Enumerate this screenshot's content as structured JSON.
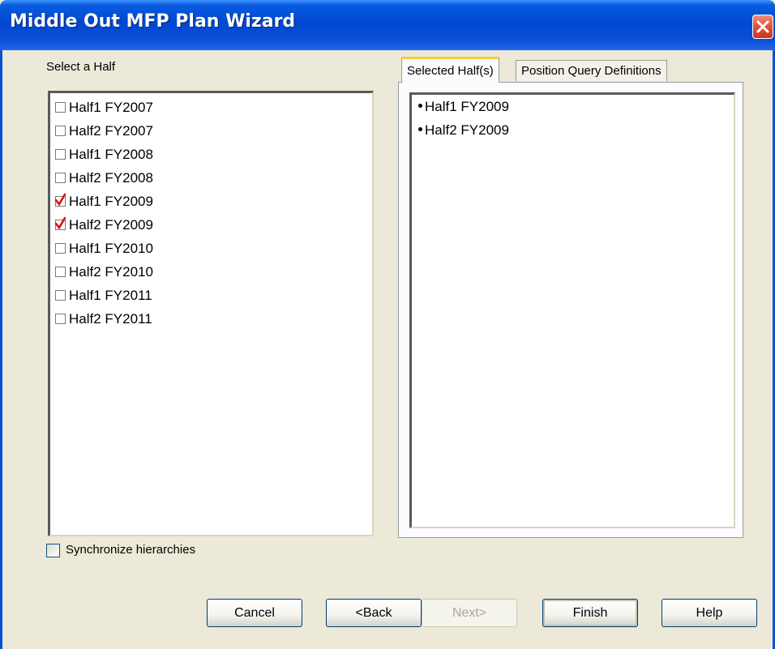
{
  "window": {
    "title": "Middle Out MFP Plan Wizard",
    "titlebar_color": "#0a4fd6",
    "close_icon": "close-icon"
  },
  "left_panel": {
    "label": "Select a Half",
    "items": [
      {
        "label": "Half1 FY2007",
        "checked": false
      },
      {
        "label": "Half2 FY2007",
        "checked": false
      },
      {
        "label": "Half1 FY2008",
        "checked": false
      },
      {
        "label": "Half2 FY2008",
        "checked": false
      },
      {
        "label": "Half1 FY2009",
        "checked": true
      },
      {
        "label": "Half2 FY2009",
        "checked": true
      },
      {
        "label": "Half1 FY2010",
        "checked": false
      },
      {
        "label": "Half2 FY2010",
        "checked": false
      },
      {
        "label": "Half1 FY2011",
        "checked": false
      },
      {
        "label": "Half2 FY2011",
        "checked": false
      }
    ],
    "check_color": "#e01010"
  },
  "tabs": [
    {
      "label": "Selected Half(s)",
      "active": true
    },
    {
      "label": "Position Query Definitions",
      "active": false
    }
  ],
  "selected_list": {
    "items": [
      "Half1 FY2009",
      "Half2 FY2009"
    ]
  },
  "sync": {
    "label": "Synchronize hierarchies",
    "checked": false
  },
  "buttons": {
    "cancel": "Cancel",
    "back": "<Back",
    "next": "Next>",
    "finish": "Finish",
    "help": "Help"
  }
}
